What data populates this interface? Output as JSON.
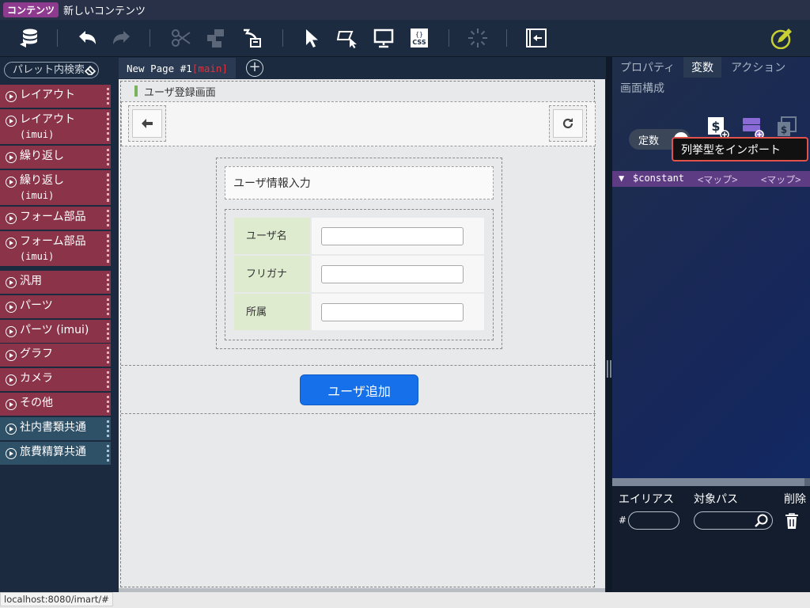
{
  "title_bar": {
    "badge": "コンテンツ",
    "title": "新しいコンテンツ"
  },
  "toolbar": {
    "icons": [
      "database-icon",
      "undo-icon",
      "redo-icon",
      "cut-icon",
      "copy-icon",
      "paste-icon",
      "select-arrow-icon",
      "area-select-icon",
      "preview-monitor-icon",
      "css-file-icon",
      "loading-spinner-icon",
      "exit-panel-icon",
      "edit-pen-icon"
    ]
  },
  "palette": {
    "search_placeholder": "パレット内検索",
    "items": [
      {
        "label": "レイアウト",
        "sub": "",
        "color": "#8b3349"
      },
      {
        "label": "レイアウト",
        "sub": "(imui)",
        "color": "#8b3349"
      },
      {
        "label": "繰り返し",
        "sub": "",
        "color": "#8b3349"
      },
      {
        "label": "繰り返し",
        "sub": "(imui)",
        "color": "#8b3349"
      },
      {
        "label": "フォーム部品",
        "sub": "",
        "color": "#8b3349"
      },
      {
        "label": "フォーム部品",
        "sub": "(imui)",
        "color": "#8b3349"
      },
      {
        "label": "汎用",
        "sub": "",
        "color": "#8b3349"
      },
      {
        "label": "パーツ",
        "sub": "",
        "color": "#8b3349"
      },
      {
        "label": "パーツ (imui)",
        "sub": "",
        "color": "#8b3349"
      },
      {
        "label": "グラフ",
        "sub": "",
        "color": "#8b3349"
      },
      {
        "label": "カメラ",
        "sub": "",
        "color": "#8b3349"
      },
      {
        "label": "その他",
        "sub": "",
        "color": "#8b3349"
      },
      {
        "label": "社内書類共通",
        "sub": "",
        "color": "#2f5168"
      },
      {
        "label": "旅費精算共通",
        "sub": "",
        "color": "#2f5168"
      }
    ]
  },
  "editor": {
    "tab_label": "New Page #1",
    "tab_main": "[main]",
    "add_tab": "+",
    "page_header": "ユーザ登録画面",
    "form_title": "ユーザ情報入力",
    "form_rows": [
      {
        "label": "ユーザ名",
        "value": ""
      },
      {
        "label": "フリガナ",
        "value": ""
      },
      {
        "label": "所属",
        "value": ""
      }
    ],
    "add_button": "ユーザ追加"
  },
  "right_panel": {
    "tabs": [
      "プロパティ",
      "変数",
      "アクション"
    ],
    "active_tab": "変数",
    "sub_tab": "画面構成",
    "constant_toggle": "定数",
    "tooltip": "列挙型をインポート",
    "constant_row": {
      "name": "$constant",
      "type1": "<マップ>",
      "type2": "<マップ>"
    },
    "bottom": {
      "alias_header": "エイリアス",
      "path_header": "対象パス",
      "delete_header": "削除",
      "hash": "#",
      "alias_value": "",
      "path_value": ""
    }
  },
  "status_bar": {
    "url": "localhost:8080/imart/#"
  }
}
